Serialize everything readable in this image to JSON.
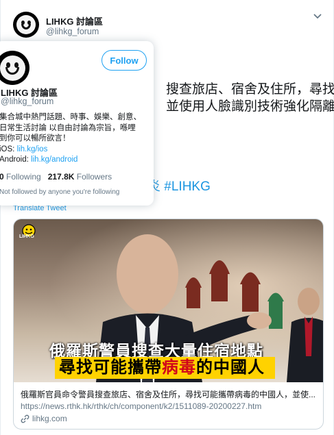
{
  "tweet": {
    "author_name": "LIHKG 討論區",
    "author_handle": "@lihkg_forum",
    "text_line1": "搜查旅店、宿舍及住所，尋找",
    "text_line2": "並使用人臉識別技術強化隔離",
    "text_line3": "炎 #LIHKG",
    "translate_label": "Translate Tweet"
  },
  "card": {
    "logo_text": "LIHKG",
    "caption_line1": "俄羅斯警員搜查大量住宿地點",
    "caption_line2_pre": "尋找可能攜帶",
    "caption_line2_highlight": "病毒",
    "caption_line2_post": "的中國人",
    "title": "俄羅斯官員命令警員搜查旅店、宿舍及住所，尋找可能攜帶病毒的中國人，並使...",
    "url": "https://news.rthk.hk/rthk/ch/component/k2/1511089-20200227.htm",
    "domain": "lihkg.com"
  },
  "popover": {
    "follow_label": "Follow",
    "name": "LIHKG 討論區",
    "handle": "@lihkg_forum",
    "bio_line1": "集合城中熱門話題、時事、娛樂、創意、",
    "bio_line2": "日常生活討論 以自由討論為宗旨，喺哩",
    "bio_line3": "到你可以暢所欲言！",
    "ios_label": "iOS:",
    "ios_link": "lih.kg/ios",
    "android_label": "Android:",
    "android_link": "lih.kg/android",
    "following_count": "0",
    "following_label": "Following",
    "followers_count": "217.8K",
    "followers_label": "Followers",
    "note": "Not followed by anyone you're following"
  },
  "colors": {
    "link_blue": "#1da1f2",
    "highlight_yellow": "#ffd200",
    "highlight_red": "#d0021b"
  }
}
